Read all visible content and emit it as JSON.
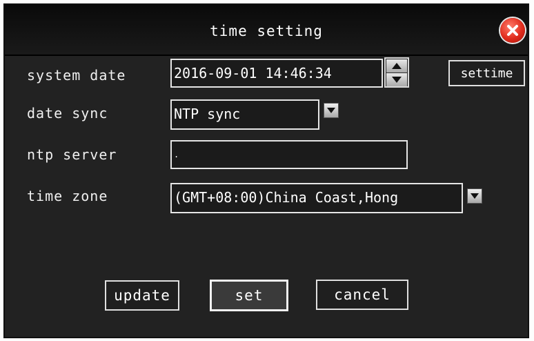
{
  "dialog": {
    "title": "time setting",
    "close_icon": "close-icon"
  },
  "system_date": {
    "label": "system date",
    "value": "2016-09-01 14:46:34",
    "settime_label": "settime"
  },
  "date_sync": {
    "label": "date sync",
    "value": "NTP sync"
  },
  "ntp_server": {
    "label": "ntp server",
    "value": "."
  },
  "time_zone": {
    "label": "time zone",
    "value": "(GMT+08:00)China Coast,Hong"
  },
  "buttons": {
    "update": "update",
    "set": "set",
    "cancel": "cancel"
  }
}
